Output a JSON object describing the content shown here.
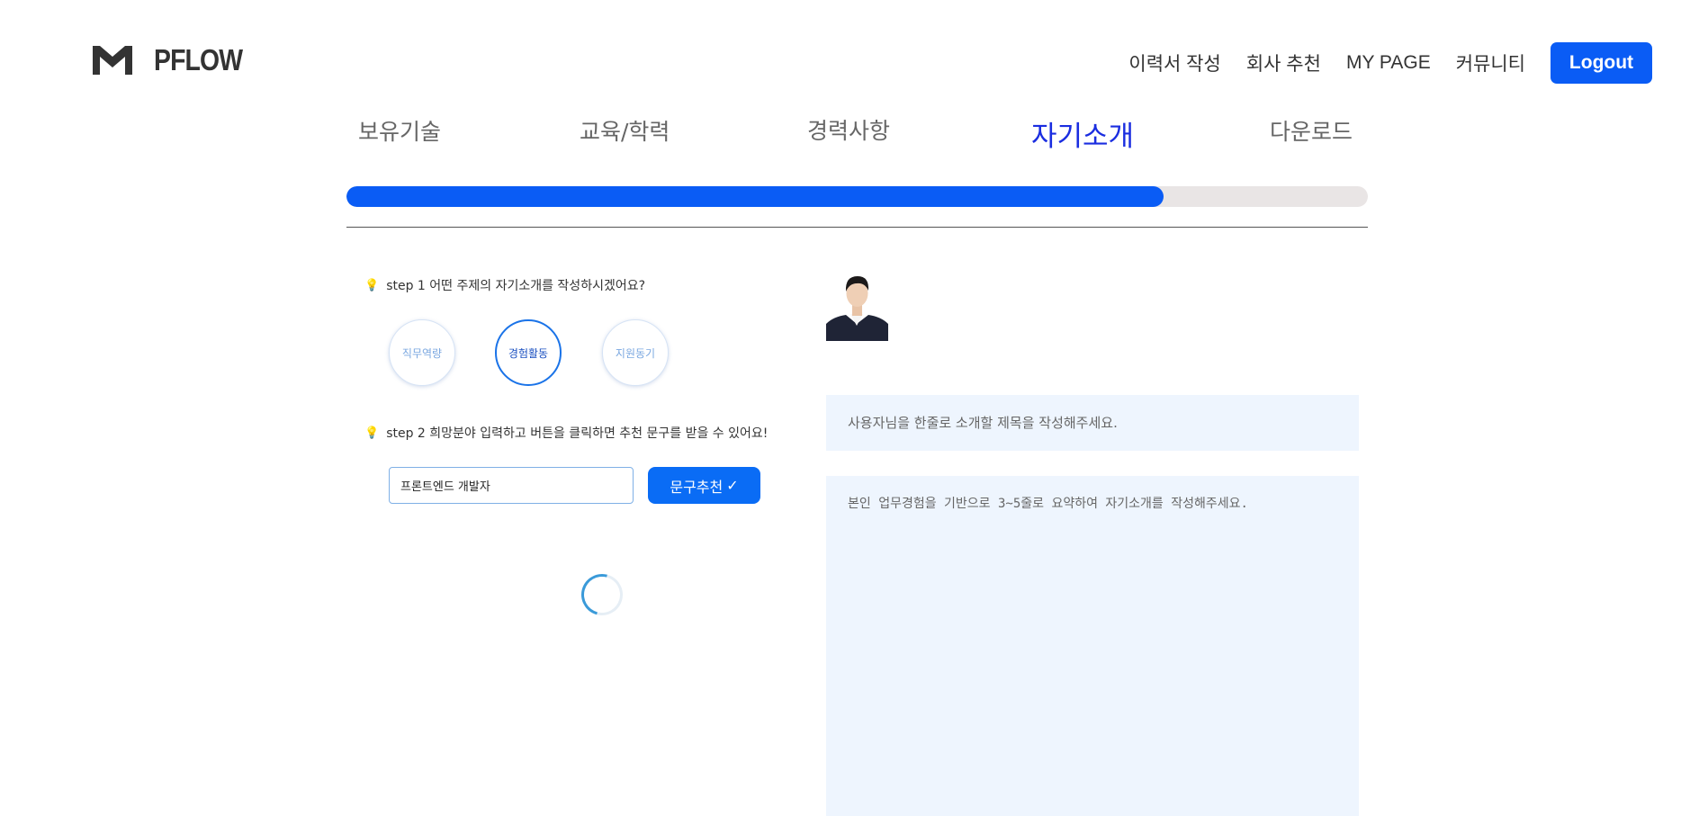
{
  "header": {
    "logo_text": "PFLOW",
    "nav": [
      "이력서 작성",
      "회사 추천",
      "MY PAGE",
      "커뮤니티"
    ],
    "logout_label": "Logout"
  },
  "steps": {
    "tabs": [
      "보유기술",
      "교육/학력",
      "경력사항",
      "자기소개",
      "다운로드"
    ],
    "active_index": 3,
    "progress_percent": 80
  },
  "left": {
    "step1_label": "step 1 어떤 주제의 자기소개를 작성하시겠어요?",
    "topics": [
      "직무역량",
      "경험활동",
      "지원동기"
    ],
    "selected_topic": "경험활동",
    "step2_label": "step 2 희망분야 입력하고 버튼을 클릭하면 추천 문구를 받을 수 있어요!",
    "field_value": "프론트엔드 개발자",
    "recommend_label": "문구추천",
    "recommend_icon": "✓"
  },
  "right": {
    "title_placeholder": "사용자님을 한줄로 소개할 제목을 작성해주세요.",
    "body_placeholder": "본인 업무경험을 기반으로 3~5줄로 요약하여 자기소개를 작성해주세요."
  },
  "colors": {
    "primary": "#0a5cf5",
    "active_tab": "#1a2de0",
    "panel_bg": "#eef5fe",
    "progress_track": "#e9e5e5"
  }
}
